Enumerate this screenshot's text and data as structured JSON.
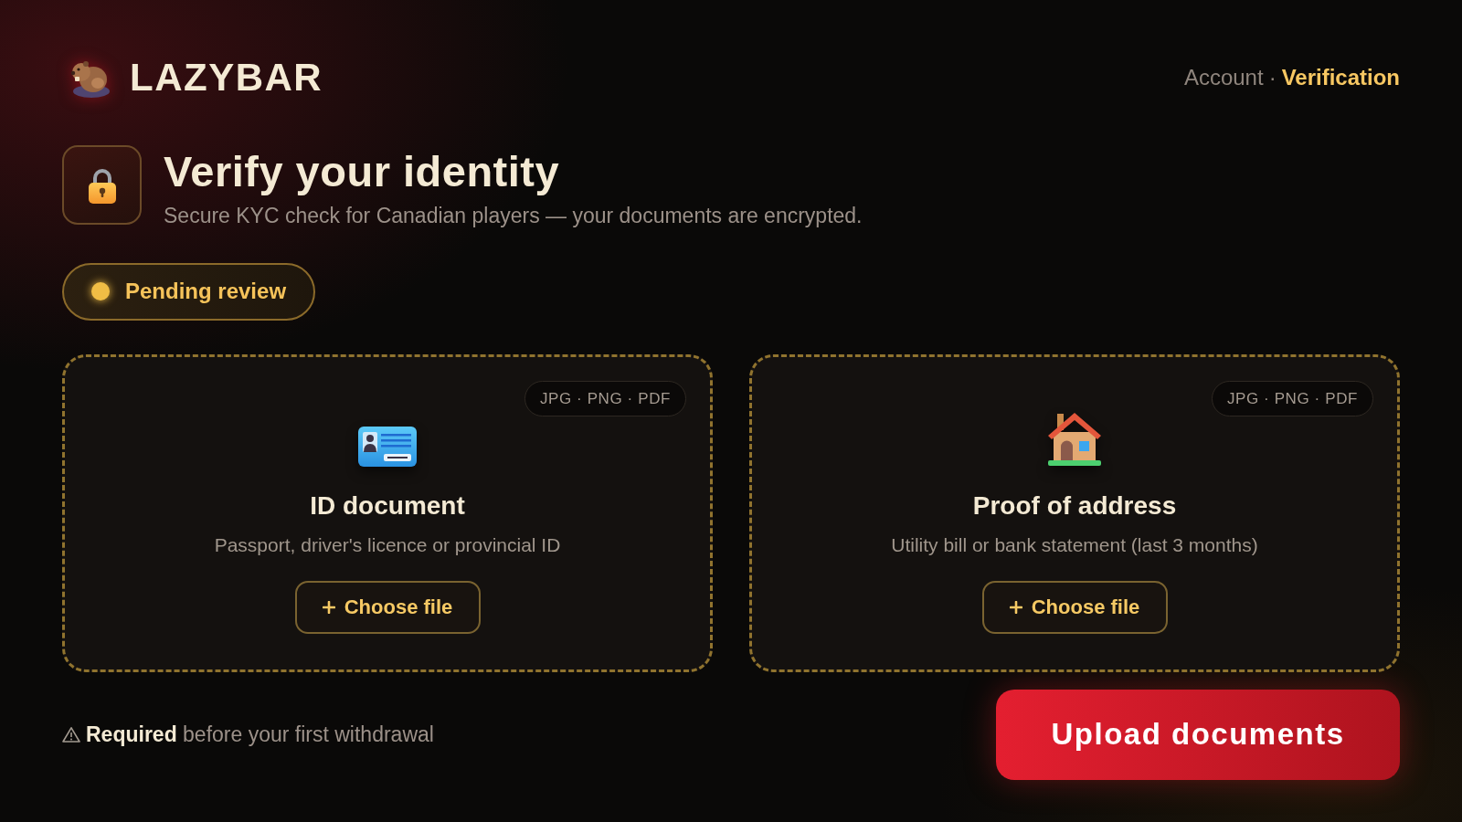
{
  "brand": {
    "name": "LAZYBAR"
  },
  "breadcrumb": {
    "separator": "·",
    "items": [
      {
        "label": "Account",
        "selected": false
      },
      {
        "label": "Verification",
        "selected": true
      }
    ]
  },
  "intro": {
    "title": "Verify your identity",
    "subtitle": "Secure KYC check for Canadian players — your documents are encrypted."
  },
  "status": {
    "kind": "pending",
    "label": "Pending review"
  },
  "documents": [
    {
      "kind": "id",
      "formats": "JPG · PNG · PDF",
      "title": "ID document",
      "description": "Passport, driver's licence or provincial ID",
      "button": "Choose file"
    },
    {
      "kind": "address",
      "formats": "JPG · PNG · PDF",
      "title": "Proof of address",
      "description": "Utility bill or bank statement (last 3 months)",
      "button": "Choose file"
    }
  ],
  "footer": {
    "note": "**Required** before your first withdrawal",
    "button": "Upload documents"
  }
}
